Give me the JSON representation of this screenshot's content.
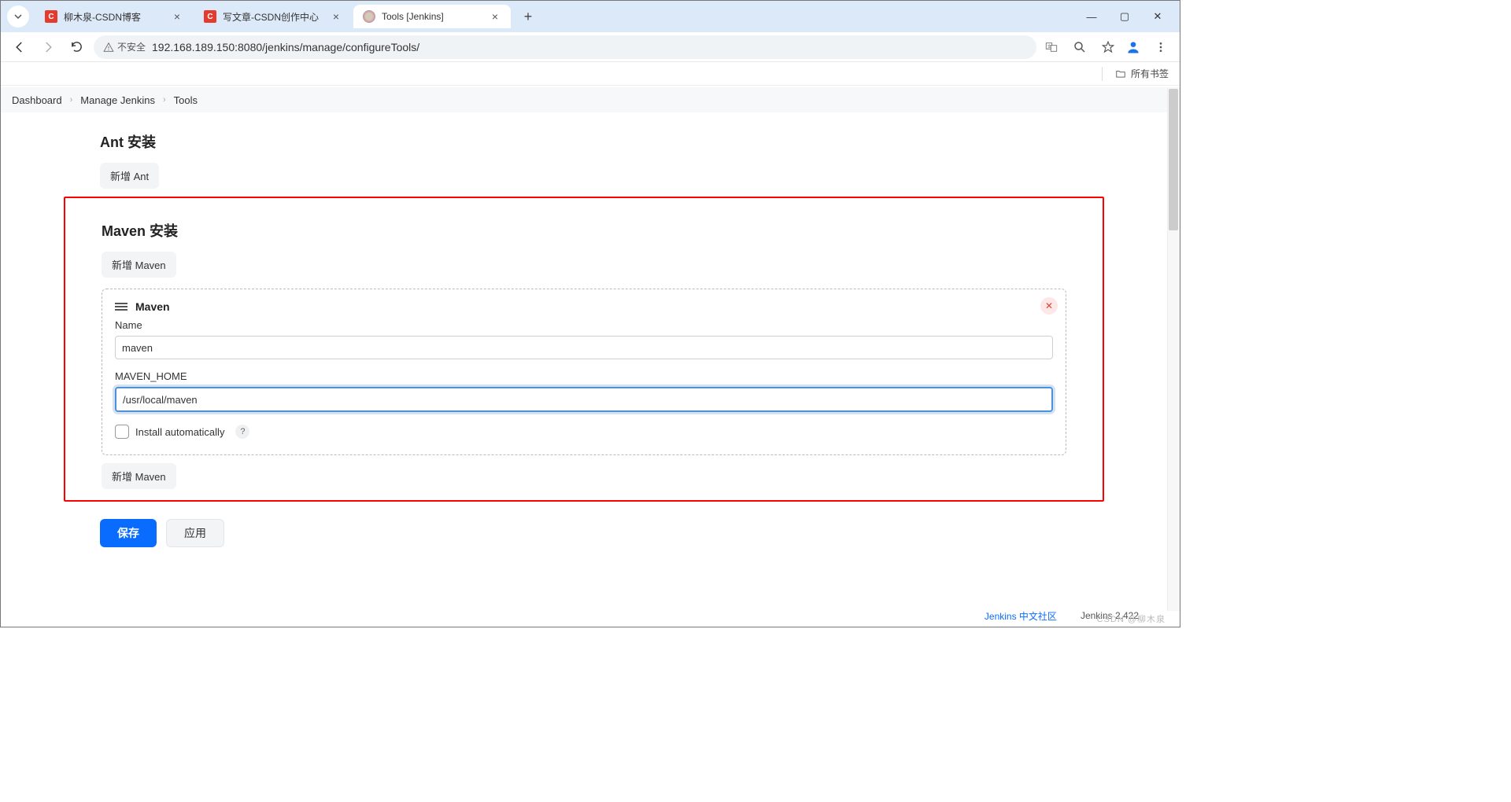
{
  "browser": {
    "tabs": [
      {
        "title": "柳木泉-CSDN博客",
        "favicon": "csdn"
      },
      {
        "title": "写文章-CSDN创作中心",
        "favicon": "csdn"
      },
      {
        "title": "Tools [Jenkins]",
        "favicon": "jenkins"
      }
    ],
    "active_tab_index": 2,
    "address": {
      "security_label": "不安全",
      "url": "192.168.189.150:8080/jenkins/manage/configureTools/"
    },
    "bookmarks_label": "所有书签",
    "window_controls": {
      "min": "—",
      "max": "▢",
      "close": "✕"
    }
  },
  "breadcrumb": [
    {
      "label": "Dashboard"
    },
    {
      "label": "Manage Jenkins"
    },
    {
      "label": "Tools"
    }
  ],
  "ant": {
    "section_title": "Ant 安装",
    "add_button": "新增 Ant"
  },
  "maven": {
    "section_title": "Maven 安装",
    "add_button_top": "新增 Maven",
    "block_title": "Maven",
    "fields": {
      "name_label": "Name",
      "name_value": "maven",
      "home_label": "MAVEN_HOME",
      "home_value": "/usr/local/maven",
      "auto_install_label": "Install automatically"
    },
    "add_button_bottom": "新增 Maven"
  },
  "actions": {
    "save": "保存",
    "apply": "应用"
  },
  "footer": {
    "community_link": "Jenkins 中文社区",
    "version": "Jenkins 2.422"
  },
  "watermark": "CSDN @柳木泉"
}
